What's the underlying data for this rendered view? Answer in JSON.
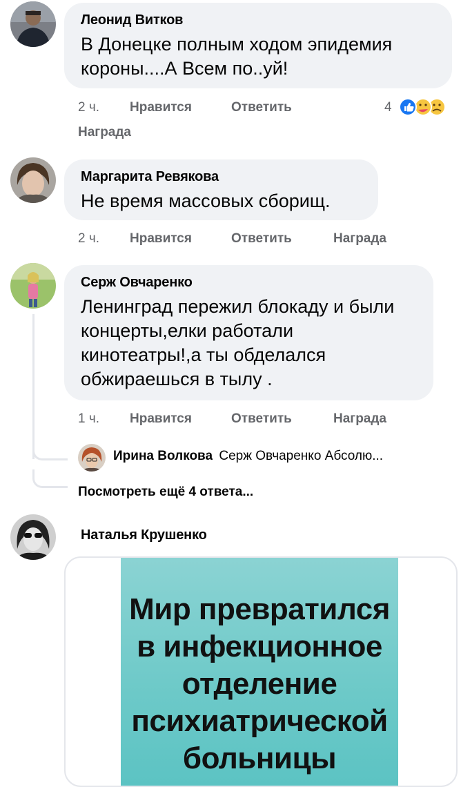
{
  "comments": [
    {
      "author": "Леонид Витков",
      "text": "В Донецке полным ходом эпидемия\nкороны....А Всем по..уй!",
      "time": "2 ч.",
      "like": "Нравится",
      "reply": "Ответить",
      "award": "Награда",
      "reaction_count": "4",
      "reactions": [
        "like-reaction-icon",
        "care-reaction-icon",
        "sad-reaction-icon"
      ]
    },
    {
      "author": "Маргарита Ревякова",
      "text": "Не время  массовых  сборищ.",
      "time": "2 ч.",
      "like": "Нравится",
      "reply": "Ответить",
      "award": "Награда"
    },
    {
      "author": "Серж Овчаренко",
      "text": "Ленинград пережил блокаду и были\nконцерты,елки работали\nкинотеатры!,а ты обделался\nобжираешься в тылу .",
      "time": "1 ч.",
      "like": "Нравится",
      "reply": "Ответить",
      "award": "Награда",
      "reply_preview": {
        "author": "Ирина Волкова",
        "text": "Серж Овчаренко Абсолю..."
      },
      "more_replies": "Посмотреть ещё 4 ответа..."
    },
    {
      "author": "Наталья Крушенко",
      "image_text": [
        "Мир превратился",
        "в инфекционное",
        "отделение",
        "психиатрической",
        "больницы"
      ]
    }
  ],
  "colors": {
    "bubble": "#f0f2f5",
    "secondary_text": "#65676b",
    "like_blue": "#1877f2",
    "poster_teal": "#6cc9c8"
  }
}
